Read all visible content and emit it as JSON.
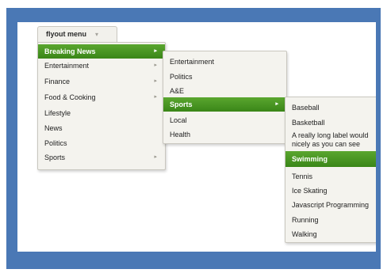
{
  "flyout_button": {
    "label": "flyout menu",
    "caret": "▾"
  },
  "colors": {
    "frame": "#4a78b5",
    "active_item": "#3f8f1e",
    "menu_background": "#f4f3ee"
  },
  "menu_level1": {
    "items": [
      {
        "label": "Breaking News",
        "arrow": "▸"
      },
      {
        "label": "Entertainment",
        "arrow": "▸"
      },
      {
        "label": "Finance",
        "arrow": "▸"
      },
      {
        "label": "Food & Cooking",
        "arrow": "▸"
      },
      {
        "label": "Lifestyle",
        "arrow": ""
      },
      {
        "label": "News",
        "arrow": ""
      },
      {
        "label": "Politics",
        "arrow": ""
      },
      {
        "label": "Sports",
        "arrow": "▸"
      }
    ],
    "active": "Breaking News"
  },
  "menu_level2": {
    "items": [
      {
        "label": "Entertainment",
        "arrow": ""
      },
      {
        "label": "Politics",
        "arrow": ""
      },
      {
        "label": "A&E",
        "arrow": ""
      },
      {
        "label": "Sports",
        "arrow": "▸"
      },
      {
        "label": "Local",
        "arrow": ""
      },
      {
        "label": "Health",
        "arrow": ""
      }
    ],
    "active": "Sports"
  },
  "menu_level3": {
    "items": [
      {
        "label": "Baseball"
      },
      {
        "label": "Basketball"
      },
      {
        "label": "A really long label would"
      },
      {
        "label": "nicely as you can see"
      },
      {
        "label": "Swimming"
      },
      {
        "label": "Tennis"
      },
      {
        "label": "Ice Skating"
      },
      {
        "label": "Javascript Programming"
      },
      {
        "label": "Running"
      },
      {
        "label": "Walking"
      }
    ],
    "active": "Swimming"
  }
}
